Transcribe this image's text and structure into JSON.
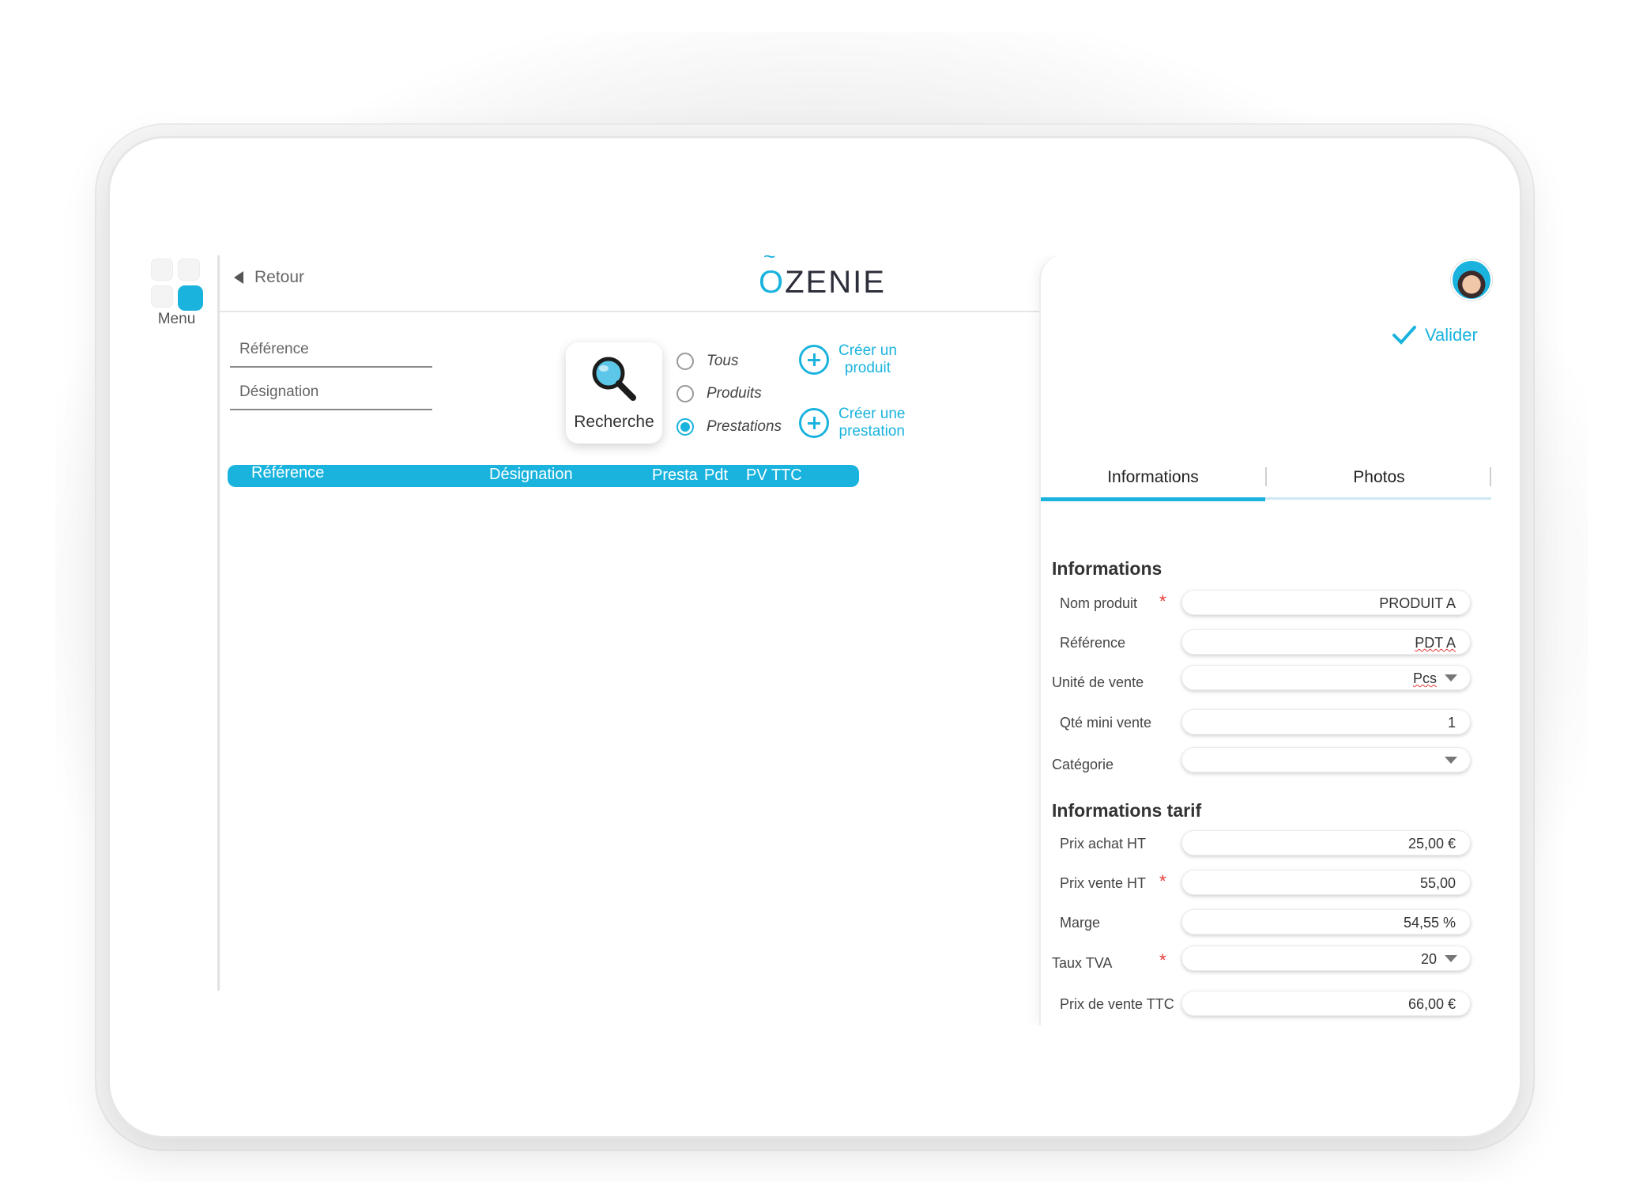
{
  "menu": {
    "label": "Menu"
  },
  "header": {
    "back_label": "Retour",
    "logo": "ZENIE",
    "logo_first": "O"
  },
  "search": {
    "reference_placeholder": "Référence",
    "designation_placeholder": "Désignation",
    "button_label": "Recherche",
    "filters": [
      {
        "label": "Tous",
        "selected": false
      },
      {
        "label": "Produits",
        "selected": false
      },
      {
        "label": "Prestations",
        "selected": true
      }
    ],
    "create_product": [
      "Créer un",
      "produit"
    ],
    "create_service": [
      "Créer une",
      "prestation"
    ]
  },
  "grid": {
    "columns": [
      "Référence",
      "Désignation",
      "Presta",
      "Pdt",
      "PV TTC"
    ]
  },
  "panel": {
    "validate_label": "Valider",
    "tabs": [
      {
        "label": "Informations",
        "active": true
      },
      {
        "label": "Photos",
        "active": false
      }
    ],
    "info_title": "Informations",
    "info_fields": [
      {
        "label": "Nom produit",
        "value": "PRODUIT A",
        "required": true
      },
      {
        "label": "Référence",
        "value": "PDT A",
        "required": false
      },
      {
        "label": "Unité de vente",
        "value": "Pcs",
        "required": false
      },
      {
        "label": "Qté mini vente",
        "value": "1",
        "required": false
      },
      {
        "label": "Catégorie",
        "value": "",
        "required": false
      }
    ],
    "tarif_title": "Informations tarif",
    "tarif_fields": [
      {
        "label": "Prix achat HT",
        "value": "25,00 €",
        "required": false
      },
      {
        "label": "Prix vente HT",
        "value": "55,00",
        "required": true
      },
      {
        "label": "Marge",
        "value": "54,55 %",
        "required": false
      },
      {
        "label": "Taux TVA",
        "value": "20",
        "required": true
      },
      {
        "label": "Prix de vente TTC",
        "value": "66,00 €",
        "required": false
      }
    ]
  },
  "colors": {
    "accent": "#1ab3de",
    "required": "#e53935"
  }
}
